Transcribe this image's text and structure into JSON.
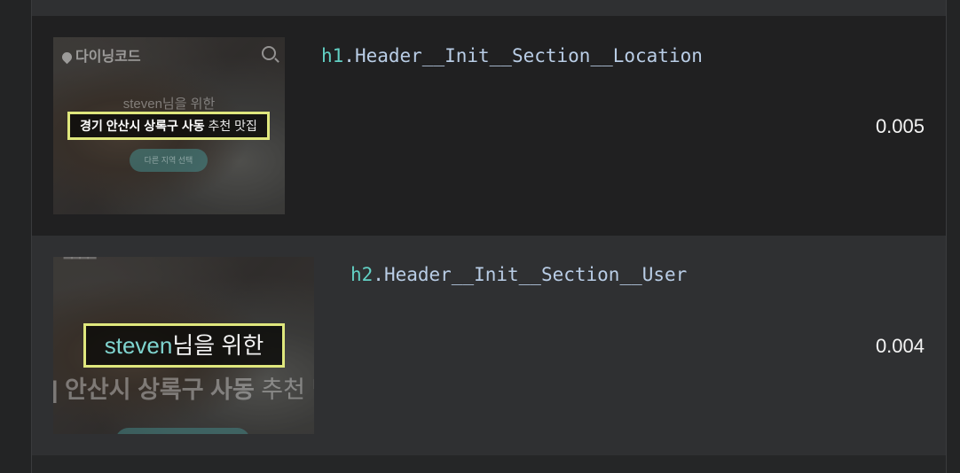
{
  "rows": [
    {
      "selector_tag": "h1",
      "selector_rest": ".Header__Init__Section__Location",
      "score": "0.005",
      "thumbnail": {
        "brand": "다이닝코드",
        "greeting": "steven님을 위한",
        "highlight_bold": "경기 안산시 상록구 사동",
        "highlight_light": "추천 맛집",
        "button": "다른 지역 선택"
      }
    },
    {
      "selector_tag": "h2",
      "selector_rest": ".Header__Init__Section__User",
      "score": "0.004",
      "thumbnail": {
        "highlight_name": "steven",
        "highlight_rest": "님을 위한",
        "location_bold": "| 안산시 상록구 사동",
        "location_light": "추천 맛"
      }
    }
  ],
  "colors": {
    "highlight_border": "#dfe77d",
    "selector_tag": "#62d0c4",
    "selector_text": "#b9cde6",
    "teal_name": "#7fd4cf"
  },
  "icons": {
    "brand_logo": "map-pin-icon",
    "search": "search-icon"
  }
}
